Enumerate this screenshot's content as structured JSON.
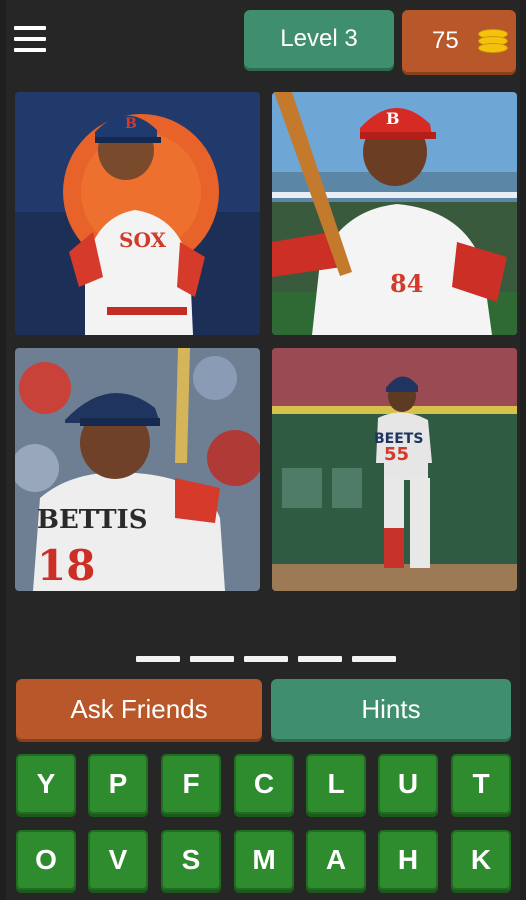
{
  "header": {
    "menu_icon": "hamburger-menu-icon",
    "level_label": "Level 3",
    "coins": "75",
    "coins_icon": "coin-stack-icon"
  },
  "images": [
    {
      "name": "photo-player-sunset-portrait"
    },
    {
      "name": "photo-player-batting-stance"
    },
    {
      "name": "photo-player-at-bat-closeup"
    },
    {
      "name": "photo-player-back-view-outfield",
      "jersey_text": "BEETS",
      "jersey_number": "55"
    }
  ],
  "answer": {
    "slot_count": 5
  },
  "actions": {
    "ask_label": "Ask Friends",
    "hints_label": "Hints"
  },
  "keyboard": {
    "row1": [
      "Y",
      "P",
      "F",
      "C",
      "L",
      "U",
      "T"
    ],
    "row2": [
      "O",
      "V",
      "S",
      "M",
      "A",
      "H",
      "K"
    ]
  },
  "colors": {
    "background": "#262626",
    "accent_green": "#3f8f6e",
    "accent_orange": "#b8572a",
    "key_green": "#2e8b2e"
  }
}
